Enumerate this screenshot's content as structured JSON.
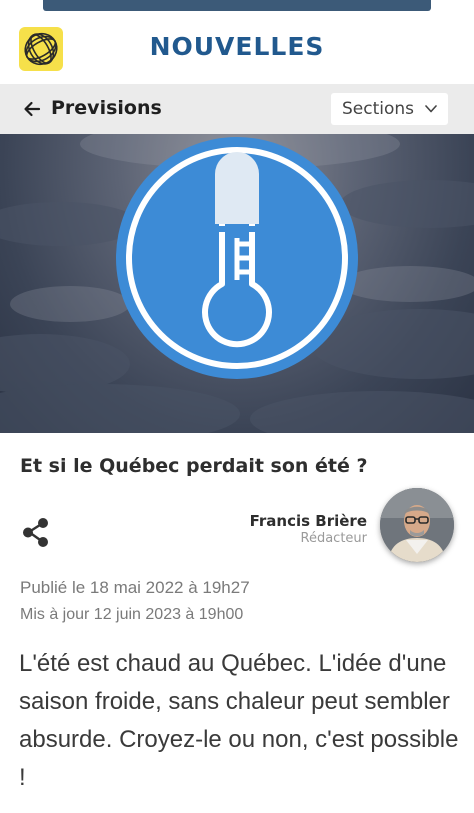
{
  "header": {
    "brand_title": "NOUVELLES",
    "logo_icon": "globe-logo-icon",
    "logo_color": "#f6e04a",
    "brand_color": "#21598e"
  },
  "subnav": {
    "back_label": "Previsions",
    "back_icon": "arrow-left-icon",
    "sections_label": "Sections",
    "sections_icon": "chevron-down-icon"
  },
  "hero": {
    "icon": "thermometer-icon",
    "accent_color": "#3d8bd6"
  },
  "article": {
    "title": "Et si le Québec perdait son été ?",
    "author_name": "Francis Brière",
    "author_role": "Rédacteur",
    "published": "Publié le 18 mai 2022 à 19h27",
    "updated": "Mis à jour 12 juin 2023 à 19h00",
    "lede": "L'été est chaud au Québec. L'idée d'une saison froide, sans chaleur peut sembler absurde. Croyez-le ou non, c'est possible !"
  }
}
